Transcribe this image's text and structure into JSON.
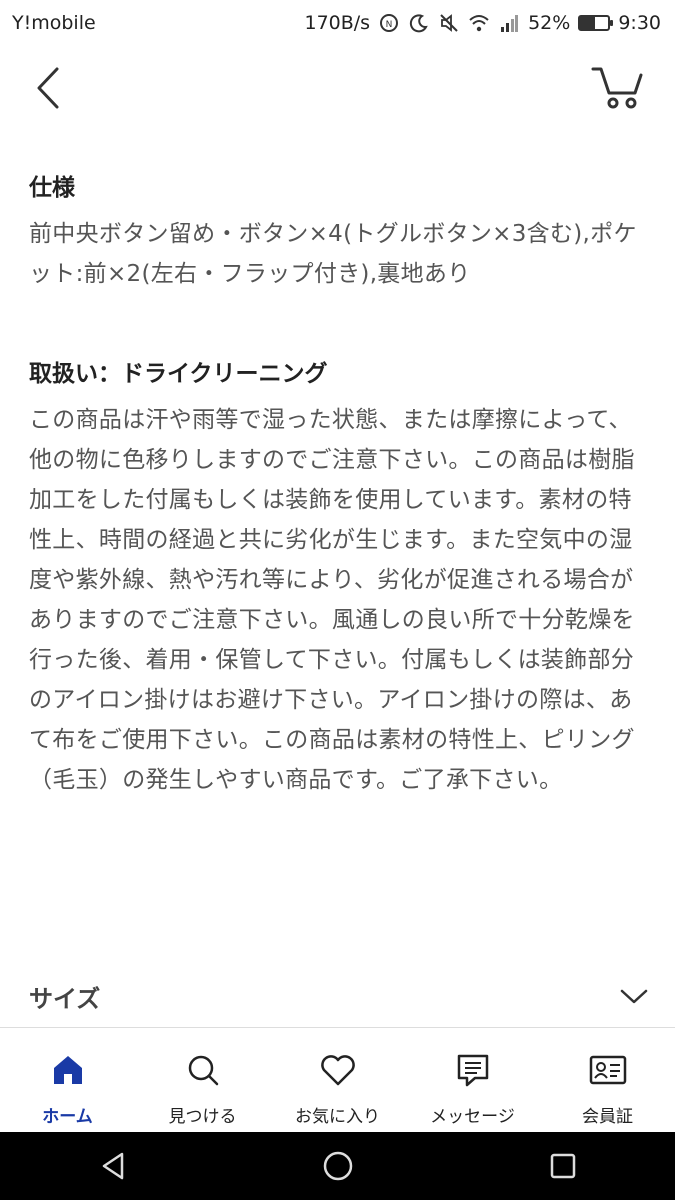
{
  "status_bar": {
    "carrier": "Y!mobile",
    "net_speed": "170B/s",
    "battery_percent": "52%",
    "battery_level": 0.52,
    "time": "9:30",
    "icons": [
      "nfc-icon",
      "moon-icon",
      "mute-icon",
      "wifi-icon",
      "signal-icon",
      "battery-icon"
    ]
  },
  "header": {
    "back_icon": "chevron-left-icon",
    "cart_icon": "cart-icon"
  },
  "spec": {
    "title": "仕様",
    "body": "前中央ボタン留め・ボタン×4(トグルボタン×3含む),ポケット:前×2(左右・フラップ付き),裏地あり"
  },
  "care": {
    "title": "取扱い：ドライクリーニング",
    "body": "この商品は汗や雨等で湿った状態、または摩擦によって、他の物に色移りしますのでご注意下さい。この商品は樹脂加工をした付属もしくは装飾を使用しています。素材の特性上、時間の経過と共に劣化が生じます。また空気中の湿度や紫外線、熱や汚れ等により、劣化が促進される場合がありますのでご注意下さい。風通しの良い所で十分乾燥を行った後、着用・保管して下さい。付属もしくは装飾部分のアイロン掛けはお避け下さい。アイロン掛けの際は、あて布をご使用下さい。この商品は素材の特性上、ピリング（毛玉）の発生しやすい商品です。ご了承下さい。"
  },
  "size_section": {
    "label": "サイズ",
    "icon": "chevron-down-icon"
  },
  "bottom_nav": {
    "items": [
      {
        "label": "ホーム",
        "icon": "home-icon",
        "active": true
      },
      {
        "label": "見つける",
        "icon": "search-icon",
        "active": false
      },
      {
        "label": "お気に入り",
        "icon": "heart-icon",
        "active": false
      },
      {
        "label": "メッセージ",
        "icon": "message-icon",
        "active": false
      },
      {
        "label": "会員証",
        "icon": "member-card-icon",
        "active": false
      }
    ]
  },
  "system_nav": {
    "icons": [
      "back-triangle-icon",
      "home-circle-icon",
      "recents-square-icon"
    ]
  },
  "colors": {
    "accent": "#1a3aa6",
    "text": "#222222",
    "body_text": "#555555",
    "system_nav_bg": "#000000"
  }
}
